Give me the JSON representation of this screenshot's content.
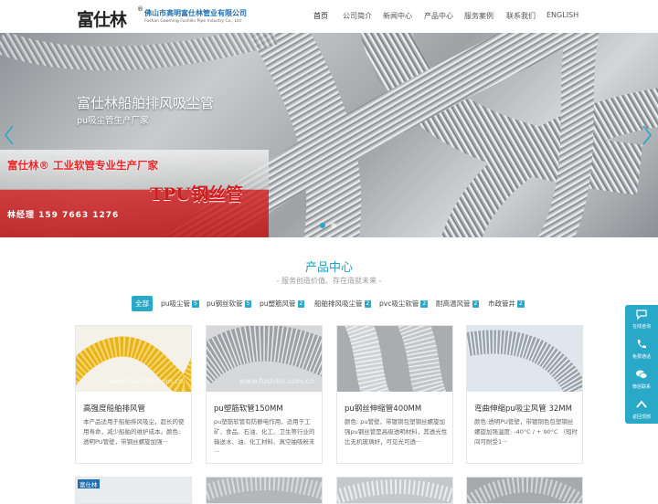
{
  "logo": {
    "main": "富仕林",
    "reg": "®",
    "company_cn": "佛山市高明富仕林管业有限公司",
    "company_en": "Foshan Gaoming Fushilin Pipe Industry Co., Ltd"
  },
  "nav": {
    "items": [
      "首页",
      "公司简介",
      "新闻中心",
      "产品中心",
      "服务案例",
      "联系我们",
      "ENGLISH"
    ],
    "active_index": 0
  },
  "banner": {
    "title": "富仕林船舶排风吸尘管",
    "subtitle": "pu吸尘管生产厂家",
    "ad_slogan": "富仕林® 工业软管专业生产厂家",
    "ad_product": "TPU钢丝管",
    "ad_phone": "林经理 159 7663 1276",
    "slide_count": 2,
    "active_slide": 0
  },
  "products": {
    "title": "产品中心",
    "subtitle": "- 服务创造价值、存在造就未来 -",
    "tabs": [
      {
        "label": "全部",
        "badge": ""
      },
      {
        "label": "pu吸尘管",
        "badge": "5"
      },
      {
        "label": "pu钢丝软管",
        "badge": "5"
      },
      {
        "label": "pu塑筋风管",
        "badge": "2"
      },
      {
        "label": "船舶排风吸尘管",
        "badge": "2"
      },
      {
        "label": "pvc吸尘软管",
        "badge": "2"
      },
      {
        "label": "耐高温风管",
        "badge": "2"
      },
      {
        "label": "市政管井",
        "badge": "2"
      }
    ],
    "watermark": "www.fushilin.com.cn",
    "cards": [
      {
        "title": "高强度船舶排风管",
        "desc": "本产品适用于船舶排风吸尘，超长的使用寿命，减少船舶的维护成本。颜色: 透明PU管壁，带钢丝螺旋加强···"
      },
      {
        "title": "pu塑筋软管150MM",
        "desc": "pu塑筋软管有防静电作用，适用于工矿、食品、石油、化工、卫生等行业的输送水、油、化工材料、真空抽吸粉末···"
      },
      {
        "title": "pu钢丝伸缩管400MM",
        "desc": "颜色: pu管壁，带镀铜包塑钢丝螺旋加强pu钢丝管是高级透明材料，其透光性比无机玻璃好，可见光可透···"
      },
      {
        "title": "弯曲伸缩pu吸尘风管 32MM",
        "desc": "颜色:透明PU管壁，带镀铜色包塑钢丝螺旋加强温度: -40°C / + 90°C （短时间可耐受1···"
      }
    ],
    "card2_label": "富仕林"
  },
  "float_bar": {
    "items": [
      "在线咨询",
      "免费通话",
      "微信联系",
      "返回顶部"
    ]
  },
  "colors": {
    "accent": "#2aa8c8",
    "ad_red": "#d01c1f"
  }
}
